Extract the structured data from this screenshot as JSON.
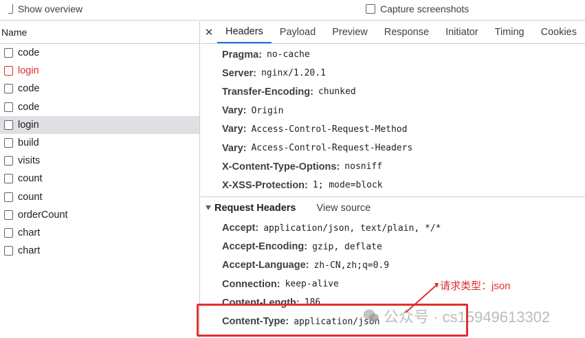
{
  "topbar": {
    "show_overview": "Show overview",
    "capture_screenshots": "Capture screenshots"
  },
  "requests": {
    "column_header": "Name",
    "items": [
      {
        "label": "code",
        "state": "normal"
      },
      {
        "label": "login",
        "state": "error"
      },
      {
        "label": "code",
        "state": "normal"
      },
      {
        "label": "code",
        "state": "normal"
      },
      {
        "label": "login",
        "state": "selected"
      },
      {
        "label": "build",
        "state": "normal"
      },
      {
        "label": "visits",
        "state": "normal"
      },
      {
        "label": "count",
        "state": "normal"
      },
      {
        "label": "count",
        "state": "normal"
      },
      {
        "label": "orderCount",
        "state": "normal"
      },
      {
        "label": "chart",
        "state": "normal"
      },
      {
        "label": "chart",
        "state": "normal"
      }
    ]
  },
  "tabs": {
    "close_glyph": "✕",
    "items": [
      "Headers",
      "Payload",
      "Preview",
      "Response",
      "Initiator",
      "Timing",
      "Cookies"
    ],
    "active": "Headers"
  },
  "response_headers": [
    {
      "name": "Pragma:",
      "value": "no-cache"
    },
    {
      "name": "Server:",
      "value": "nginx/1.20.1"
    },
    {
      "name": "Transfer-Encoding:",
      "value": "chunked"
    },
    {
      "name": "Vary:",
      "value": "Origin"
    },
    {
      "name": "Vary:",
      "value": "Access-Control-Request-Method"
    },
    {
      "name": "Vary:",
      "value": "Access-Control-Request-Headers"
    },
    {
      "name": "X-Content-Type-Options:",
      "value": "nosniff"
    },
    {
      "name": "X-XSS-Protection:",
      "value": "1; mode=block"
    }
  ],
  "request_section": {
    "title": "Request Headers",
    "view_source": "View source"
  },
  "request_headers": [
    {
      "name": "Accept:",
      "value": "application/json, text/plain, */*"
    },
    {
      "name": "Accept-Encoding:",
      "value": "gzip, deflate"
    },
    {
      "name": "Accept-Language:",
      "value": "zh-CN,zh;q=0.9"
    },
    {
      "name": "Connection:",
      "value": "keep-alive"
    },
    {
      "name": "Content-Length:",
      "value": "186"
    },
    {
      "name": "Content-Type:",
      "value": "application/json"
    }
  ],
  "annotation": {
    "text": "请求类型：json",
    "color": "#e0302e"
  },
  "watermark": {
    "text": "公众号 · cs15949613302"
  }
}
